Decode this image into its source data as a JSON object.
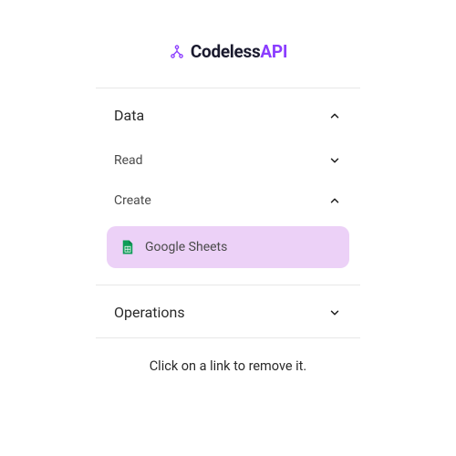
{
  "logo": {
    "text_main": "Codeless",
    "text_accent": "API"
  },
  "sections": {
    "data": {
      "title": "Data",
      "expanded": true,
      "subsections": {
        "read": {
          "title": "Read",
          "expanded": false
        },
        "create": {
          "title": "Create",
          "expanded": true,
          "items": [
            {
              "label": "Google Sheets",
              "icon": "google-sheets"
            }
          ]
        }
      }
    },
    "operations": {
      "title": "Operations",
      "expanded": false
    }
  },
  "footer": {
    "hint": "Click on a link to remove it."
  },
  "colors": {
    "accent": "#8b3dff",
    "highlight_bg": "#ecd1f7",
    "sheets_green": "#0f9d58"
  }
}
